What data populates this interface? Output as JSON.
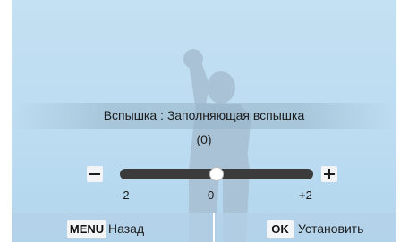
{
  "colors": {
    "background": "#c4e0f3",
    "slider_track": "#3b3b3b",
    "knob": "#ffffff"
  },
  "flash_menu": {
    "title": "Вспышка : Заполняющая вспышка",
    "value_display": "(0)",
    "slider": {
      "min_icon": "minus-icon",
      "max_icon": "plus-icon",
      "min": -2,
      "max": 2,
      "value": 0,
      "tick_labels": [
        "-2",
        "0",
        "+2"
      ]
    }
  },
  "bottom_bar": {
    "menu_key": "MENU",
    "back_label": "Назад",
    "ok_key": "OK",
    "set_label": "Установить"
  }
}
